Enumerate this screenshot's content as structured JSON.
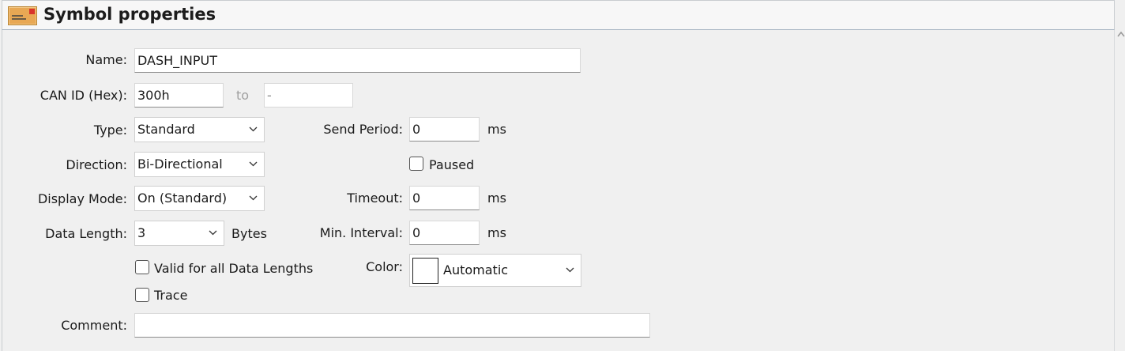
{
  "header": {
    "title": "Symbol properties",
    "icon": "envelope-icon"
  },
  "form": {
    "name": {
      "label": "Name:",
      "value": "DASH_INPUT"
    },
    "can_id": {
      "label": "CAN ID (Hex):",
      "value": "300h",
      "to_label": "to",
      "to_value": "-"
    },
    "type": {
      "label": "Type:",
      "value": "Standard"
    },
    "direction": {
      "label": "Direction:",
      "value": "Bi-Directional"
    },
    "display_mode": {
      "label": "Display Mode:",
      "value": "On (Standard)"
    },
    "data_length": {
      "label": "Data Length:",
      "value": "3",
      "unit": "Bytes"
    },
    "valid_all": {
      "label": "Valid for all Data Lengths",
      "checked": false
    },
    "trace": {
      "label": "Trace",
      "checked": false
    },
    "comment": {
      "label": "Comment:",
      "value": ""
    },
    "send_period": {
      "label": "Send Period:",
      "value": "0",
      "unit": "ms"
    },
    "paused": {
      "label": "Paused",
      "checked": false
    },
    "timeout": {
      "label": "Timeout:",
      "value": "0",
      "unit": "ms"
    },
    "min_interval": {
      "label": "Min. Interval:",
      "value": "0",
      "unit": "ms"
    },
    "color": {
      "label": "Color:",
      "value": "Automatic",
      "swatch": "#ffffff"
    }
  },
  "colors": {
    "header_bg": "#f7f7f7",
    "panel_bg": "#f0f0f0",
    "icon_orange": "#e8a854",
    "icon_red": "#d9342b"
  }
}
